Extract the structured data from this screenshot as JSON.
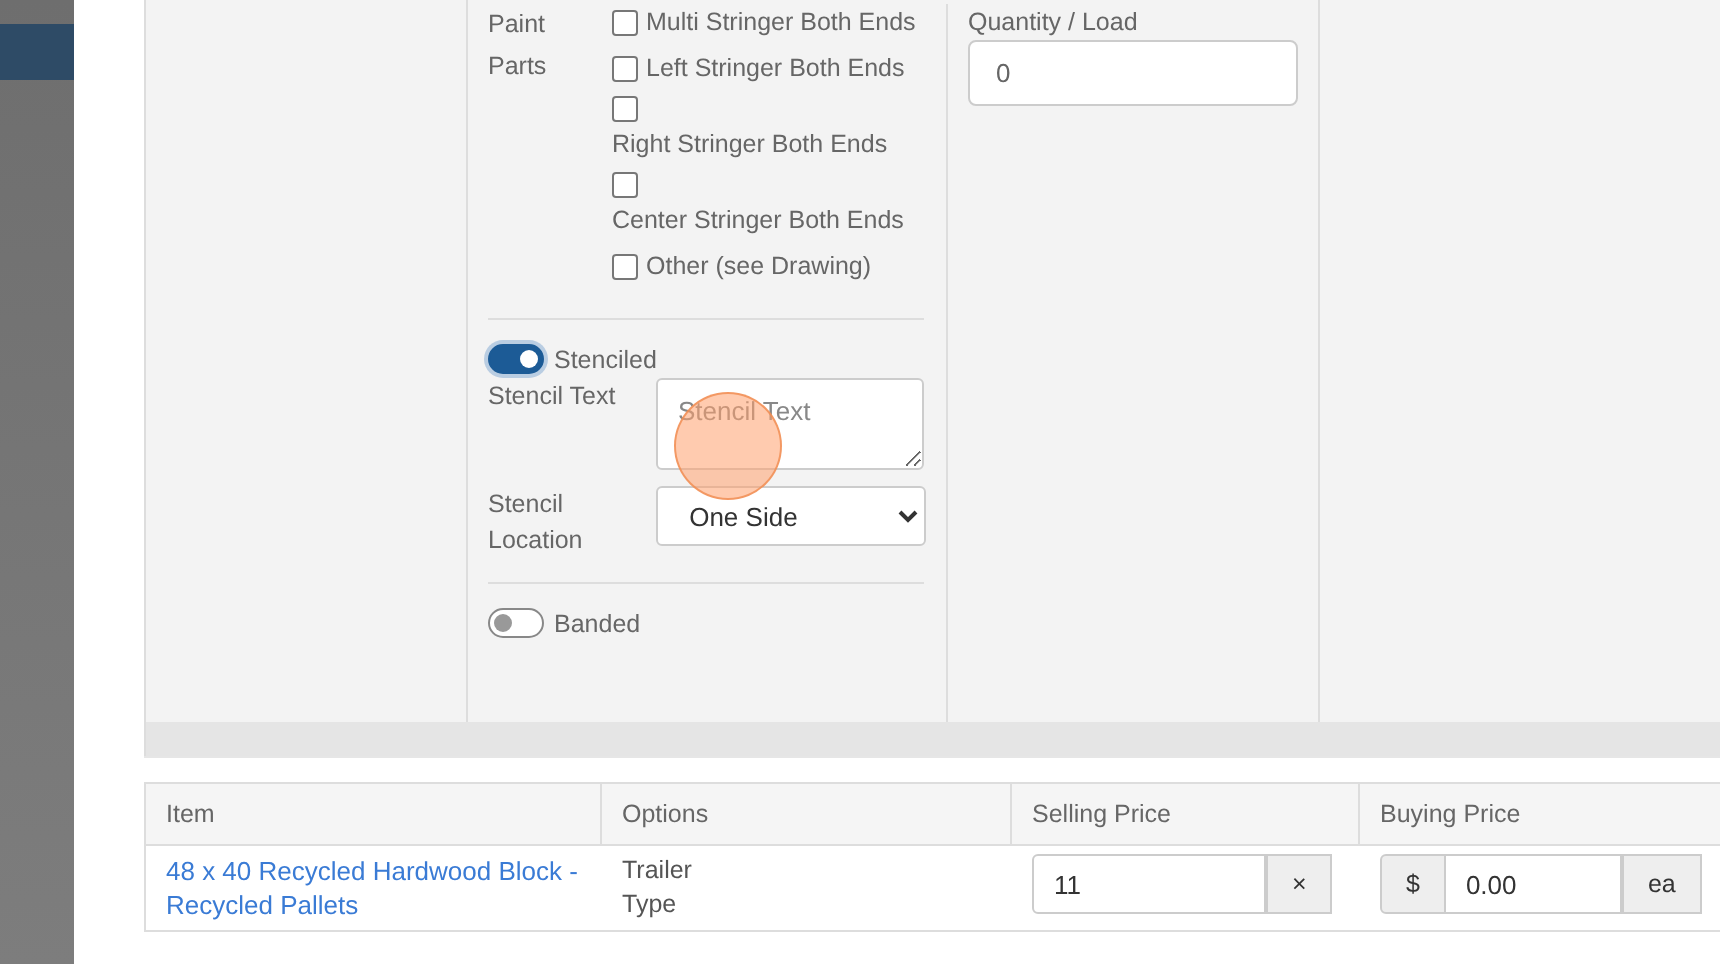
{
  "paint_parts": {
    "label": "Paint Parts",
    "options": [
      {
        "label": "Multi Stringer Both Ends",
        "checked": false,
        "kind": "inline"
      },
      {
        "label": "Left Stringer Both Ends",
        "checked": false,
        "kind": "inline"
      },
      {
        "label": "Right Stringer Both Ends",
        "checked": false,
        "kind": "stacked"
      },
      {
        "label": "Center Stringer Both Ends",
        "checked": false,
        "kind": "stacked"
      },
      {
        "label": "Other (see Drawing)",
        "checked": false,
        "kind": "inline"
      }
    ]
  },
  "stenciled": {
    "label": "Stenciled",
    "on": true
  },
  "stencil_text": {
    "label": "Stencil Text",
    "placeholder": "Stencil Text"
  },
  "stencil_location": {
    "label": "Stencil Location",
    "value": "One Side"
  },
  "banded": {
    "label": "Banded",
    "on": false
  },
  "quantity_load": {
    "label": "Quantity / Load",
    "value": "0"
  },
  "table": {
    "columns": [
      "Item",
      "Options",
      "Selling Price",
      "Buying Price"
    ],
    "rows": [
      {
        "item": "48 x 40 Recycled Hardwood Block - Recycled Pallets",
        "options": "Trailer Type",
        "selling_price": "11",
        "clear": "×",
        "currency": "$",
        "buying_price": "0.00",
        "unit": "ea"
      }
    ]
  }
}
